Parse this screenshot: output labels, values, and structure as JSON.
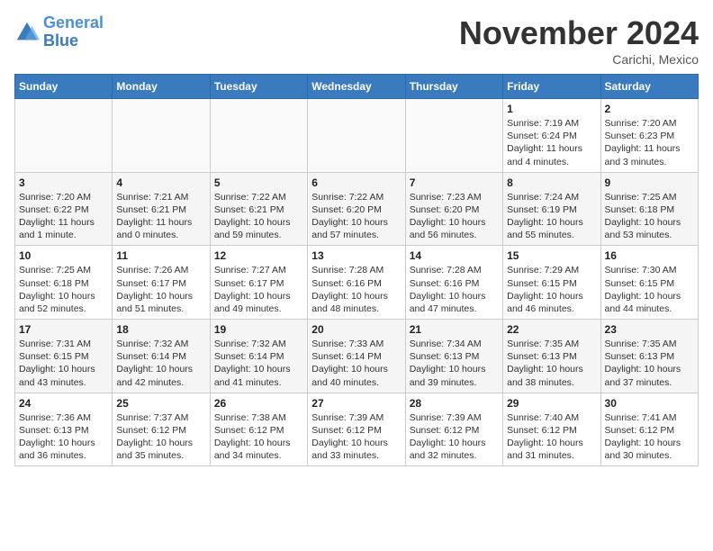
{
  "logo": {
    "line1": "General",
    "line2": "Blue"
  },
  "title": "November 2024",
  "location": "Carichi, Mexico",
  "weekdays": [
    "Sunday",
    "Monday",
    "Tuesday",
    "Wednesday",
    "Thursday",
    "Friday",
    "Saturday"
  ],
  "weeks": [
    [
      {
        "day": "",
        "info": ""
      },
      {
        "day": "",
        "info": ""
      },
      {
        "day": "",
        "info": ""
      },
      {
        "day": "",
        "info": ""
      },
      {
        "day": "",
        "info": ""
      },
      {
        "day": "1",
        "info": "Sunrise: 7:19 AM\nSunset: 6:24 PM\nDaylight: 11 hours and 4 minutes."
      },
      {
        "day": "2",
        "info": "Sunrise: 7:20 AM\nSunset: 6:23 PM\nDaylight: 11 hours and 3 minutes."
      }
    ],
    [
      {
        "day": "3",
        "info": "Sunrise: 7:20 AM\nSunset: 6:22 PM\nDaylight: 11 hours and 1 minute."
      },
      {
        "day": "4",
        "info": "Sunrise: 7:21 AM\nSunset: 6:21 PM\nDaylight: 11 hours and 0 minutes."
      },
      {
        "day": "5",
        "info": "Sunrise: 7:22 AM\nSunset: 6:21 PM\nDaylight: 10 hours and 59 minutes."
      },
      {
        "day": "6",
        "info": "Sunrise: 7:22 AM\nSunset: 6:20 PM\nDaylight: 10 hours and 57 minutes."
      },
      {
        "day": "7",
        "info": "Sunrise: 7:23 AM\nSunset: 6:20 PM\nDaylight: 10 hours and 56 minutes."
      },
      {
        "day": "8",
        "info": "Sunrise: 7:24 AM\nSunset: 6:19 PM\nDaylight: 10 hours and 55 minutes."
      },
      {
        "day": "9",
        "info": "Sunrise: 7:25 AM\nSunset: 6:18 PM\nDaylight: 10 hours and 53 minutes."
      }
    ],
    [
      {
        "day": "10",
        "info": "Sunrise: 7:25 AM\nSunset: 6:18 PM\nDaylight: 10 hours and 52 minutes."
      },
      {
        "day": "11",
        "info": "Sunrise: 7:26 AM\nSunset: 6:17 PM\nDaylight: 10 hours and 51 minutes."
      },
      {
        "day": "12",
        "info": "Sunrise: 7:27 AM\nSunset: 6:17 PM\nDaylight: 10 hours and 49 minutes."
      },
      {
        "day": "13",
        "info": "Sunrise: 7:28 AM\nSunset: 6:16 PM\nDaylight: 10 hours and 48 minutes."
      },
      {
        "day": "14",
        "info": "Sunrise: 7:28 AM\nSunset: 6:16 PM\nDaylight: 10 hours and 47 minutes."
      },
      {
        "day": "15",
        "info": "Sunrise: 7:29 AM\nSunset: 6:15 PM\nDaylight: 10 hours and 46 minutes."
      },
      {
        "day": "16",
        "info": "Sunrise: 7:30 AM\nSunset: 6:15 PM\nDaylight: 10 hours and 44 minutes."
      }
    ],
    [
      {
        "day": "17",
        "info": "Sunrise: 7:31 AM\nSunset: 6:15 PM\nDaylight: 10 hours and 43 minutes."
      },
      {
        "day": "18",
        "info": "Sunrise: 7:32 AM\nSunset: 6:14 PM\nDaylight: 10 hours and 42 minutes."
      },
      {
        "day": "19",
        "info": "Sunrise: 7:32 AM\nSunset: 6:14 PM\nDaylight: 10 hours and 41 minutes."
      },
      {
        "day": "20",
        "info": "Sunrise: 7:33 AM\nSunset: 6:14 PM\nDaylight: 10 hours and 40 minutes."
      },
      {
        "day": "21",
        "info": "Sunrise: 7:34 AM\nSunset: 6:13 PM\nDaylight: 10 hours and 39 minutes."
      },
      {
        "day": "22",
        "info": "Sunrise: 7:35 AM\nSunset: 6:13 PM\nDaylight: 10 hours and 38 minutes."
      },
      {
        "day": "23",
        "info": "Sunrise: 7:35 AM\nSunset: 6:13 PM\nDaylight: 10 hours and 37 minutes."
      }
    ],
    [
      {
        "day": "24",
        "info": "Sunrise: 7:36 AM\nSunset: 6:13 PM\nDaylight: 10 hours and 36 minutes."
      },
      {
        "day": "25",
        "info": "Sunrise: 7:37 AM\nSunset: 6:12 PM\nDaylight: 10 hours and 35 minutes."
      },
      {
        "day": "26",
        "info": "Sunrise: 7:38 AM\nSunset: 6:12 PM\nDaylight: 10 hours and 34 minutes."
      },
      {
        "day": "27",
        "info": "Sunrise: 7:39 AM\nSunset: 6:12 PM\nDaylight: 10 hours and 33 minutes."
      },
      {
        "day": "28",
        "info": "Sunrise: 7:39 AM\nSunset: 6:12 PM\nDaylight: 10 hours and 32 minutes."
      },
      {
        "day": "29",
        "info": "Sunrise: 7:40 AM\nSunset: 6:12 PM\nDaylight: 10 hours and 31 minutes."
      },
      {
        "day": "30",
        "info": "Sunrise: 7:41 AM\nSunset: 6:12 PM\nDaylight: 10 hours and 30 minutes."
      }
    ]
  ]
}
